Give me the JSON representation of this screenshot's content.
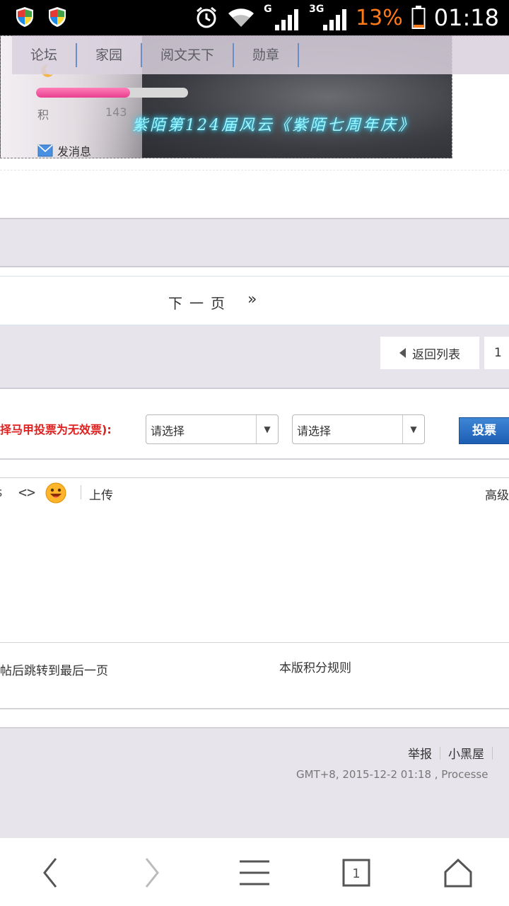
{
  "status_bar": {
    "network_g": "G",
    "network_3g": "3G",
    "battery": "13%",
    "time": "01:18",
    "icons": [
      "shield-icon",
      "shield-icon",
      "alarm-icon",
      "wifi-icon",
      "signal-icon",
      "signal-icon",
      "battery-icon"
    ]
  },
  "nav": {
    "items": [
      {
        "label": "论坛"
      },
      {
        "label": "家园"
      },
      {
        "label": "阅文天下"
      },
      {
        "label": "勋章"
      }
    ]
  },
  "profile": {
    "banner_title": "紫陌第124届风云《紫陌七周年庆》",
    "score_label": "积",
    "score_value": "143",
    "progress_fraction": 0.62,
    "message_label": "发消息"
  },
  "pagination": {
    "next_label": "下一页",
    "next_arrow": "»",
    "back_label": "返回列表",
    "page_value": "1"
  },
  "vote": {
    "note": "择马甲投票为无效票):",
    "select1_value": "请选择",
    "select2_value": "请选择",
    "button_label": "投票"
  },
  "editor": {
    "partial_label": "s",
    "code_label": "<>",
    "upload_label": "上传",
    "advanced_label": "高级"
  },
  "options": {
    "jump_text": "帖后跳转到最后一页",
    "rules_link": "本版积分规则"
  },
  "footer": {
    "links": [
      "举报",
      "小黑屋"
    ],
    "info": "GMT+8, 2015-12-2 01:18 , Processe"
  },
  "browser": {
    "tab_count": "1"
  },
  "colors": {
    "band": "#e8e4eb",
    "vote_note": "#e01f1f",
    "vote_button": "#1d5fb3",
    "battery": "#ff7a1a"
  }
}
